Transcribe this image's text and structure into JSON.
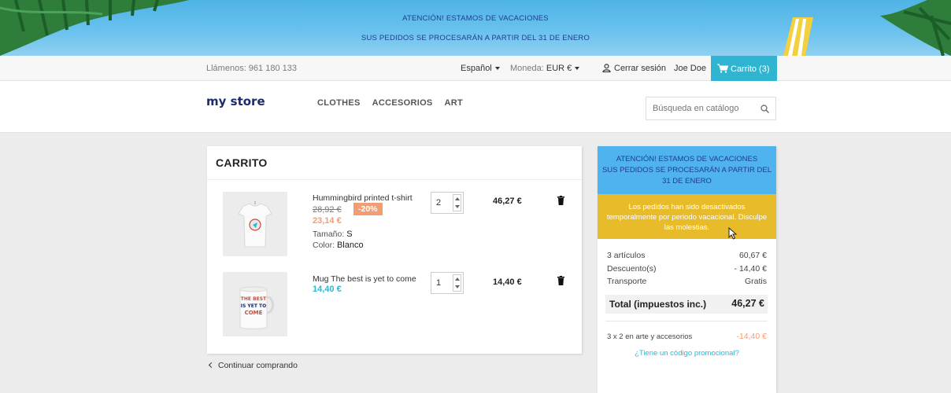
{
  "banner": {
    "line1": "ATENCIÓN! ESTAMOS DE VACACIONES",
    "line2": "SUS PEDIDOS SE PROCESARÁN A PARTIR DEL 31 DE ENERO"
  },
  "nav": {
    "phone": "Llámenos: 961 180 133",
    "language": "Español",
    "currency_label": "Moneda:",
    "currency_value": "EUR €",
    "logout": "Cerrar sesión",
    "user": "Joe Doe",
    "cart": "Carrito (3)"
  },
  "header": {
    "logo_my": "my",
    "logo_store": "store",
    "menu": [
      "CLOTHES",
      "ACCESORIOS",
      "ART"
    ],
    "search_placeholder": "Búsqueda en catálogo"
  },
  "cart": {
    "title": "CARRITO",
    "items": [
      {
        "name": "Hummingbird printed t-shirt",
        "old_price": "28,92 €",
        "discount": "-20%",
        "price": "23,14 €",
        "size_label": "Tamaño:",
        "size_value": "S",
        "color_label": "Color:",
        "color_value": "Blanco",
        "quantity": "2",
        "total": "46,27 €",
        "mug_text": ""
      },
      {
        "name": "Mug The best is yet to come",
        "price": "14,40 €",
        "quantity": "1",
        "total": "14,40 €",
        "mug_text": [
          "THE BEST",
          "IS YET TO",
          "COME"
        ]
      }
    ],
    "continue": "Continuar comprando"
  },
  "summary": {
    "vacation_line1": "ATENCIÓN! ESTAMOS DE VACACIONES",
    "vacation_line2": "SUS PEDIDOS SE PROCESARÁN A PARTIR DEL 31 DE ENERO",
    "warning": "Los pedidos han sido desactivados temporalmente por periodo vacacional. Disculpe las molestias.",
    "articles_label": "3 artículos",
    "articles_value": "60,67 €",
    "discount_label": "Descuento(s)",
    "discount_value": "- 14,40 €",
    "shipping_label": "Transporte",
    "shipping_value": "Gratis",
    "total_label": "Total (impuestos inc.)",
    "total_value": "46,27 €",
    "promo_label": "3 x 2 en arte y accesorios",
    "promo_value": "-14,40 €",
    "promo_link": "¿Tiene un código promocional?"
  },
  "colors": {
    "accent": "#2fb5d2",
    "discount": "#f39d72",
    "warning": "#e8bb2a",
    "vacation": "#4fb3ef"
  },
  "icons": [
    "palm-tree-icon",
    "beach-chair-icon",
    "user-icon",
    "shopping-cart-icon",
    "search-icon",
    "trash-icon",
    "chevron-left-icon",
    "mouse-cursor-icon"
  ]
}
